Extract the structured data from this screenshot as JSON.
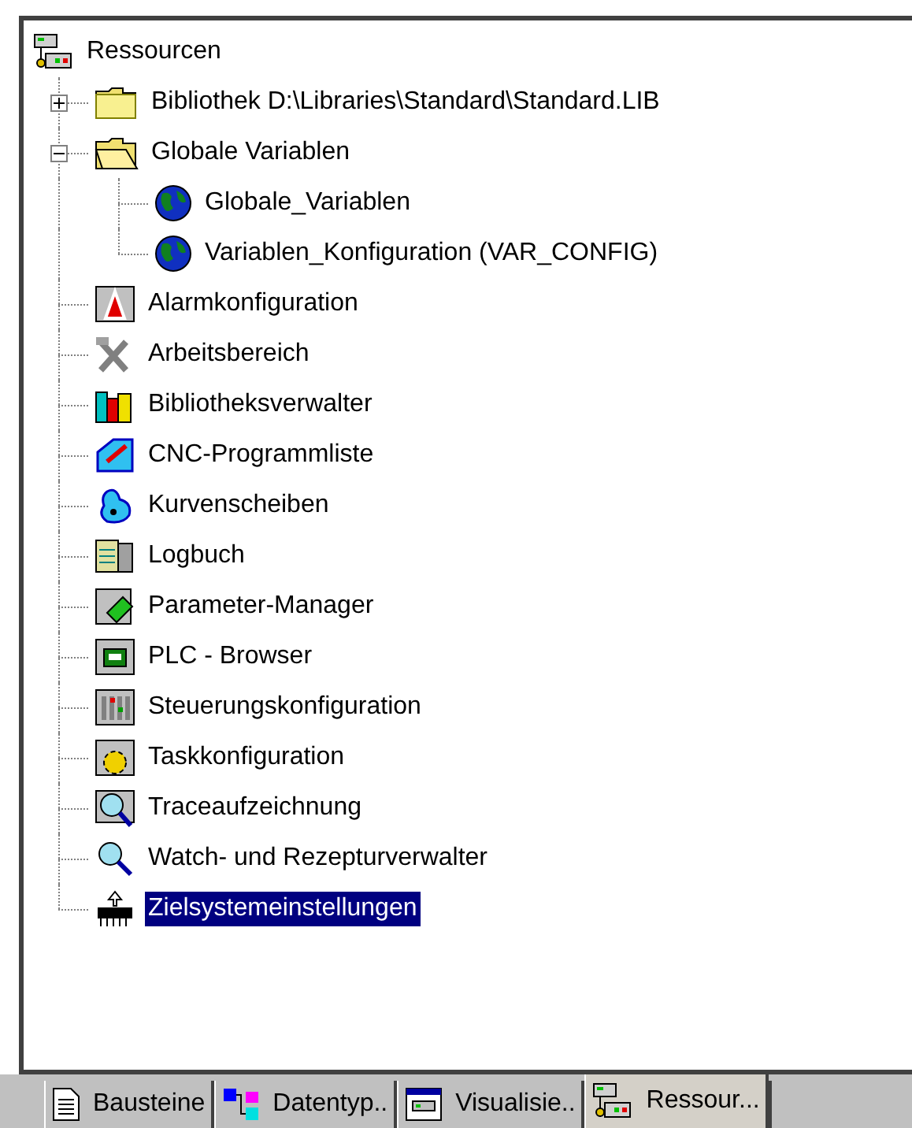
{
  "tree": {
    "label": "Ressourcen",
    "selected": false,
    "children": [
      {
        "label": "Bibliothek D:\\Libraries\\Standard\\Standard.LIB",
        "selected": false,
        "expanded": false
      },
      {
        "label": "Globale Variablen",
        "selected": false,
        "expanded": true,
        "children": [
          {
            "label": "Globale_Variablen",
            "selected": false
          },
          {
            "label": "Variablen_Konfiguration (VAR_CONFIG)",
            "selected": false
          }
        ]
      },
      {
        "label": "Alarmkonfiguration",
        "selected": false
      },
      {
        "label": "Arbeitsbereich",
        "selected": false
      },
      {
        "label": "Bibliotheksverwalter",
        "selected": false
      },
      {
        "label": "CNC-Programmliste",
        "selected": false
      },
      {
        "label": "Kurvenscheiben",
        "selected": false
      },
      {
        "label": "Logbuch",
        "selected": false
      },
      {
        "label": "Parameter-Manager",
        "selected": false
      },
      {
        "label": "PLC - Browser",
        "selected": false
      },
      {
        "label": "Steuerungskonfiguration",
        "selected": false
      },
      {
        "label": "Taskkonfiguration",
        "selected": false
      },
      {
        "label": "Traceaufzeichnung",
        "selected": false
      },
      {
        "label": "Watch- und Rezepturverwalter",
        "selected": false
      },
      {
        "label": "Zielsystemeinstellungen",
        "selected": true
      }
    ]
  },
  "tabs": [
    {
      "label": "Bausteine",
      "selected": false
    },
    {
      "label": "Datentyp..",
      "selected": false
    },
    {
      "label": "Visualisie..",
      "selected": false
    },
    {
      "label": "Ressour...",
      "selected": true
    }
  ]
}
